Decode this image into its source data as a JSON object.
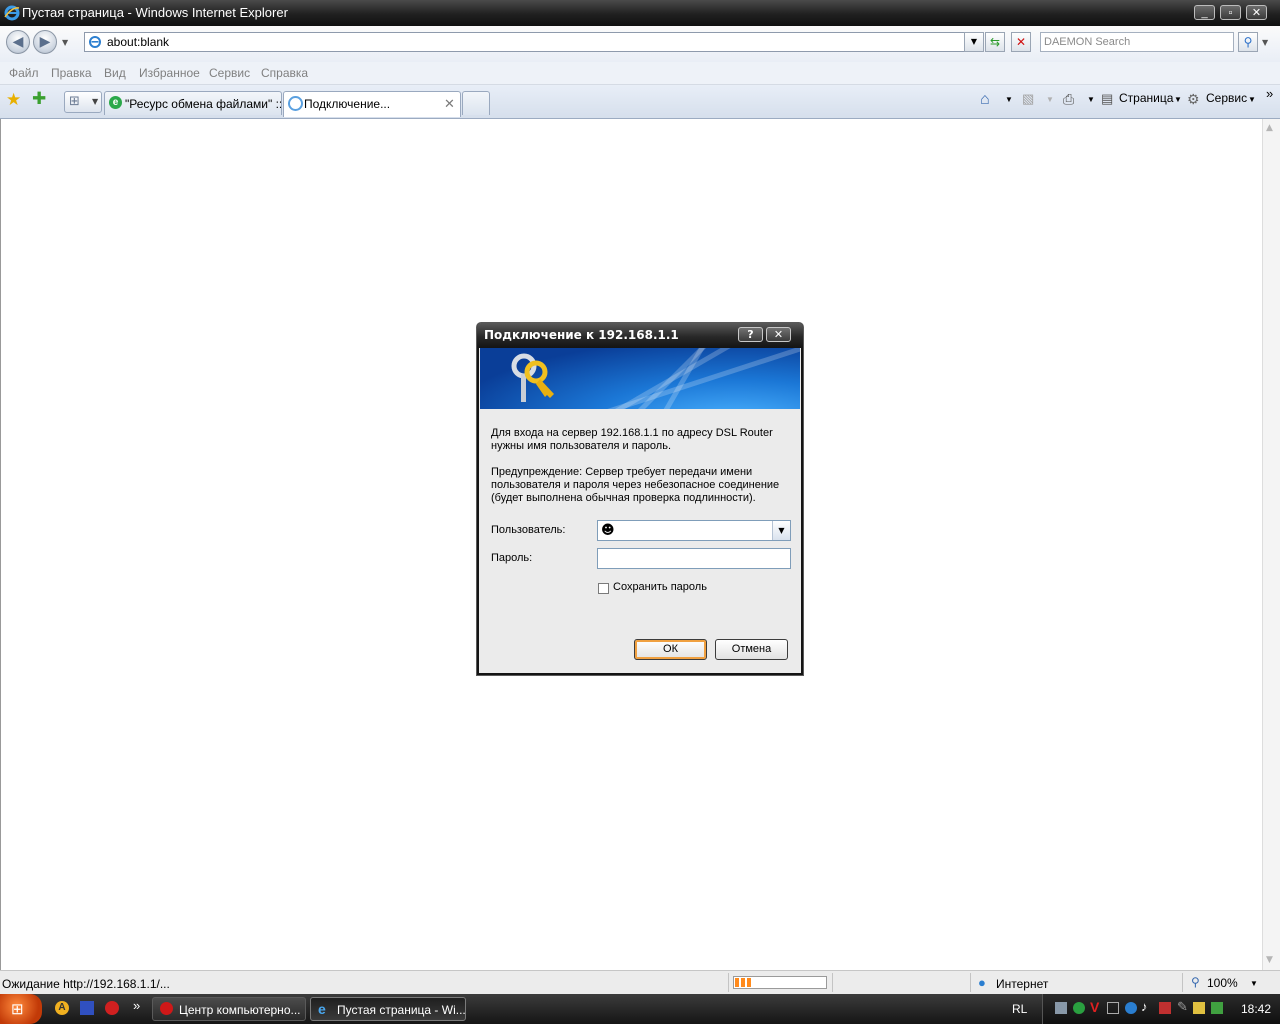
{
  "window": {
    "title": "Пустая страница - Windows Internet Explorer",
    "min": "_",
    "max": "▫",
    "close": "✕"
  },
  "nav": {
    "url": "about:blank",
    "search_placeholder": "DAEMON Search"
  },
  "menu": [
    "Файл",
    "Правка",
    "Вид",
    "Избранное",
    "Сервис",
    "Справка"
  ],
  "tabs": [
    {
      "label": "\"Ресурс обмена файлами\" ::..."
    },
    {
      "label": "Подключение..."
    }
  ],
  "commands": {
    "page": "Страница",
    "tools": "Сервис"
  },
  "dialog": {
    "title": "Подключение к 192.168.1.1",
    "help": "?",
    "close": "✕",
    "intro": "Для входа на сервер 192.168.1.1 по адресу DSL Router нужны имя пользователя и пароль.",
    "warning": "Предупреждение: Сервер требует передачи имени пользователя и пароля через небезопасное соединение (будет выполнена обычная проверка подлинности).",
    "user_label": "Пользователь:",
    "password_label": "Пароль:",
    "remember_label": "Сохранить пароль",
    "ok": "ОК",
    "cancel": "Отмена"
  },
  "status": {
    "text": "Ожидание http://192.168.1.1/...",
    "zone": "Интернет",
    "zoom": "100%",
    "progress": 0.2
  },
  "taskbar": {
    "tasks": [
      {
        "label": "Центр компьютерно..."
      },
      {
        "label": "Пустая страница - Wi..."
      }
    ],
    "lang": "RL",
    "clock": "18:42",
    "chevron": "»"
  }
}
